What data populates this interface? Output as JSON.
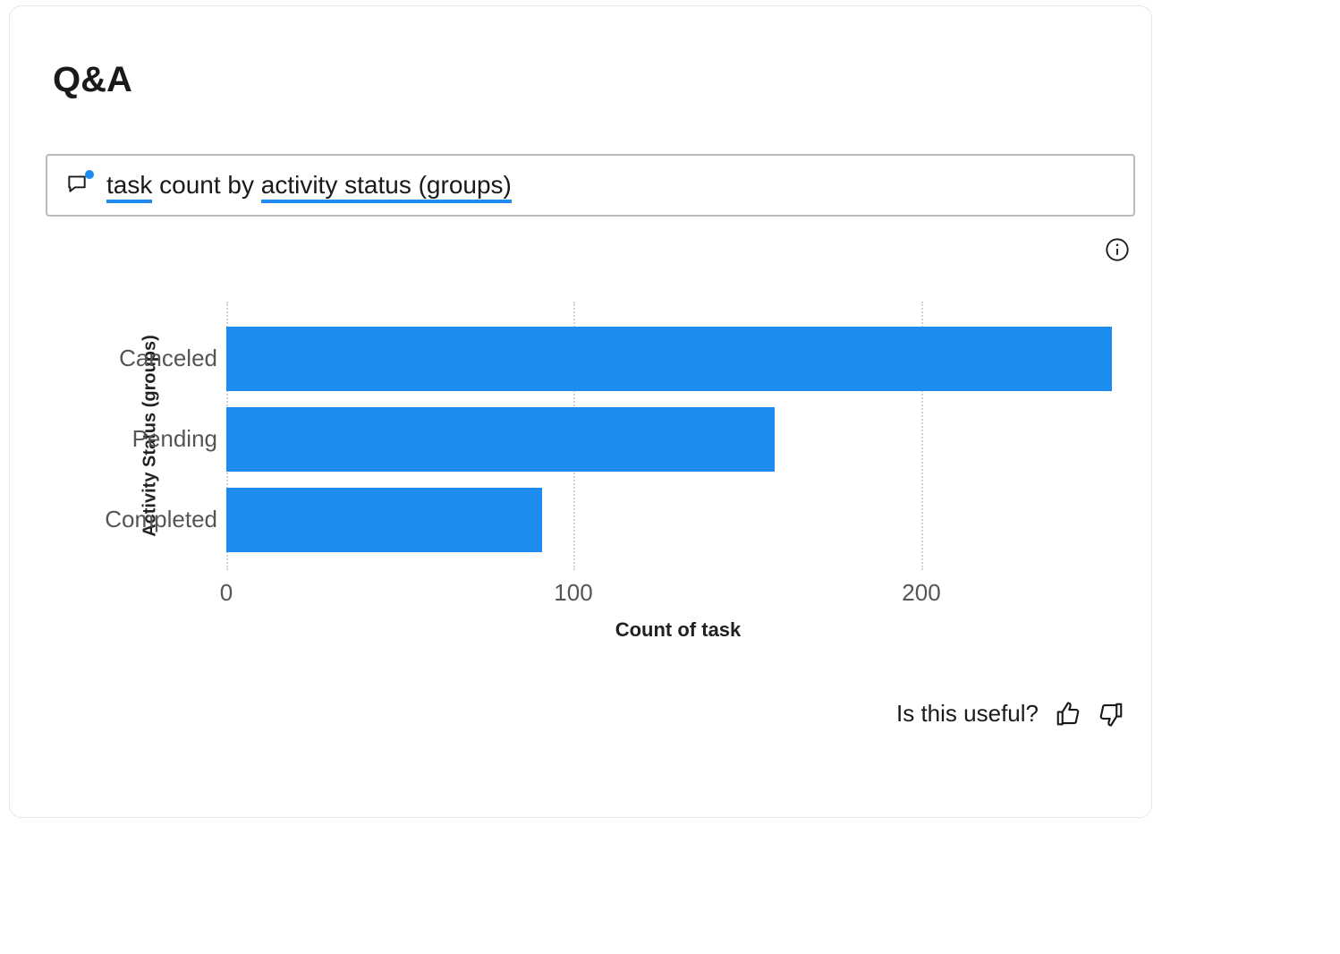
{
  "header": {
    "title": "Q&A"
  },
  "query": {
    "segments": {
      "s1": "task",
      "s2": " count by ",
      "s3": "activity status (groups)"
    }
  },
  "feedback": {
    "prompt": "Is this useful?"
  },
  "chart_data": {
    "type": "bar",
    "orientation": "horizontal",
    "categories": [
      "Canceled",
      "Pending",
      "Completed"
    ],
    "values": [
      255,
      158,
      91
    ],
    "xlabel": "Count of task",
    "ylabel": "Activity Status (groups)",
    "xlim": [
      0,
      260
    ],
    "xticks": [
      0,
      100,
      200
    ],
    "bar_color": "#1c8cf0"
  }
}
